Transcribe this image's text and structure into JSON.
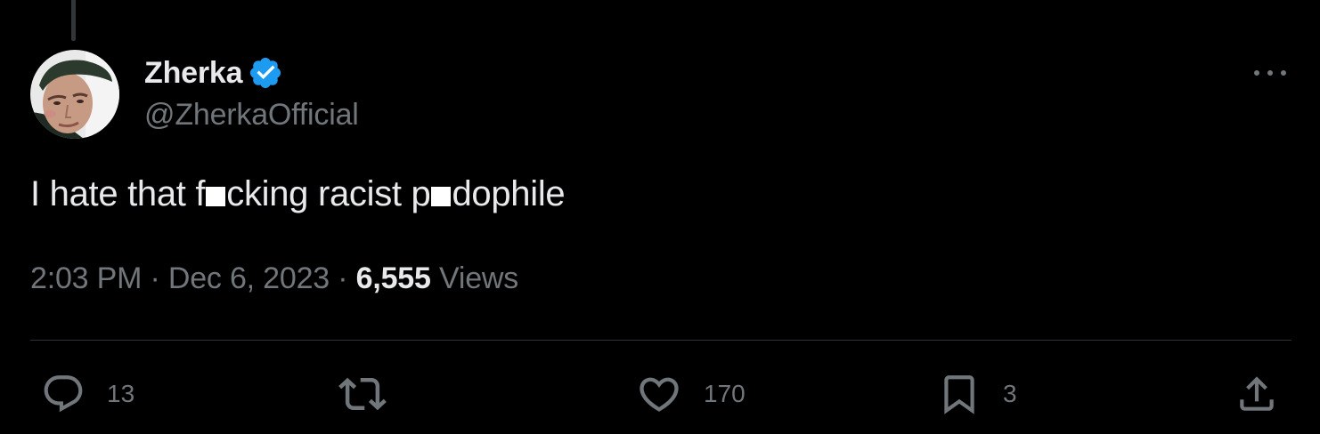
{
  "author": {
    "display_name": "Zherka",
    "handle": "@ZherkaOfficial",
    "verified": true,
    "verified_color": "#1d9bf0"
  },
  "tweet": {
    "text_parts": [
      "I hate that f",
      "cking racist p",
      "dophile"
    ],
    "censor_color": "#ffffff"
  },
  "meta": {
    "time": "2:03 PM",
    "separator": "·",
    "date": "Dec 6, 2023",
    "views_count": "6,555",
    "views_label": "Views"
  },
  "actions": {
    "reply": {
      "icon": "reply-icon",
      "count": "13"
    },
    "retweet": {
      "icon": "retweet-icon",
      "count": ""
    },
    "like": {
      "icon": "heart-icon",
      "count": "170"
    },
    "bookmark": {
      "icon": "bookmark-icon",
      "count": "3"
    },
    "share": {
      "icon": "share-icon"
    }
  },
  "colors": {
    "background": "#000000",
    "primary_text": "#e7e9ea",
    "secondary_text": "#71767b",
    "divider": "#2f3336"
  }
}
